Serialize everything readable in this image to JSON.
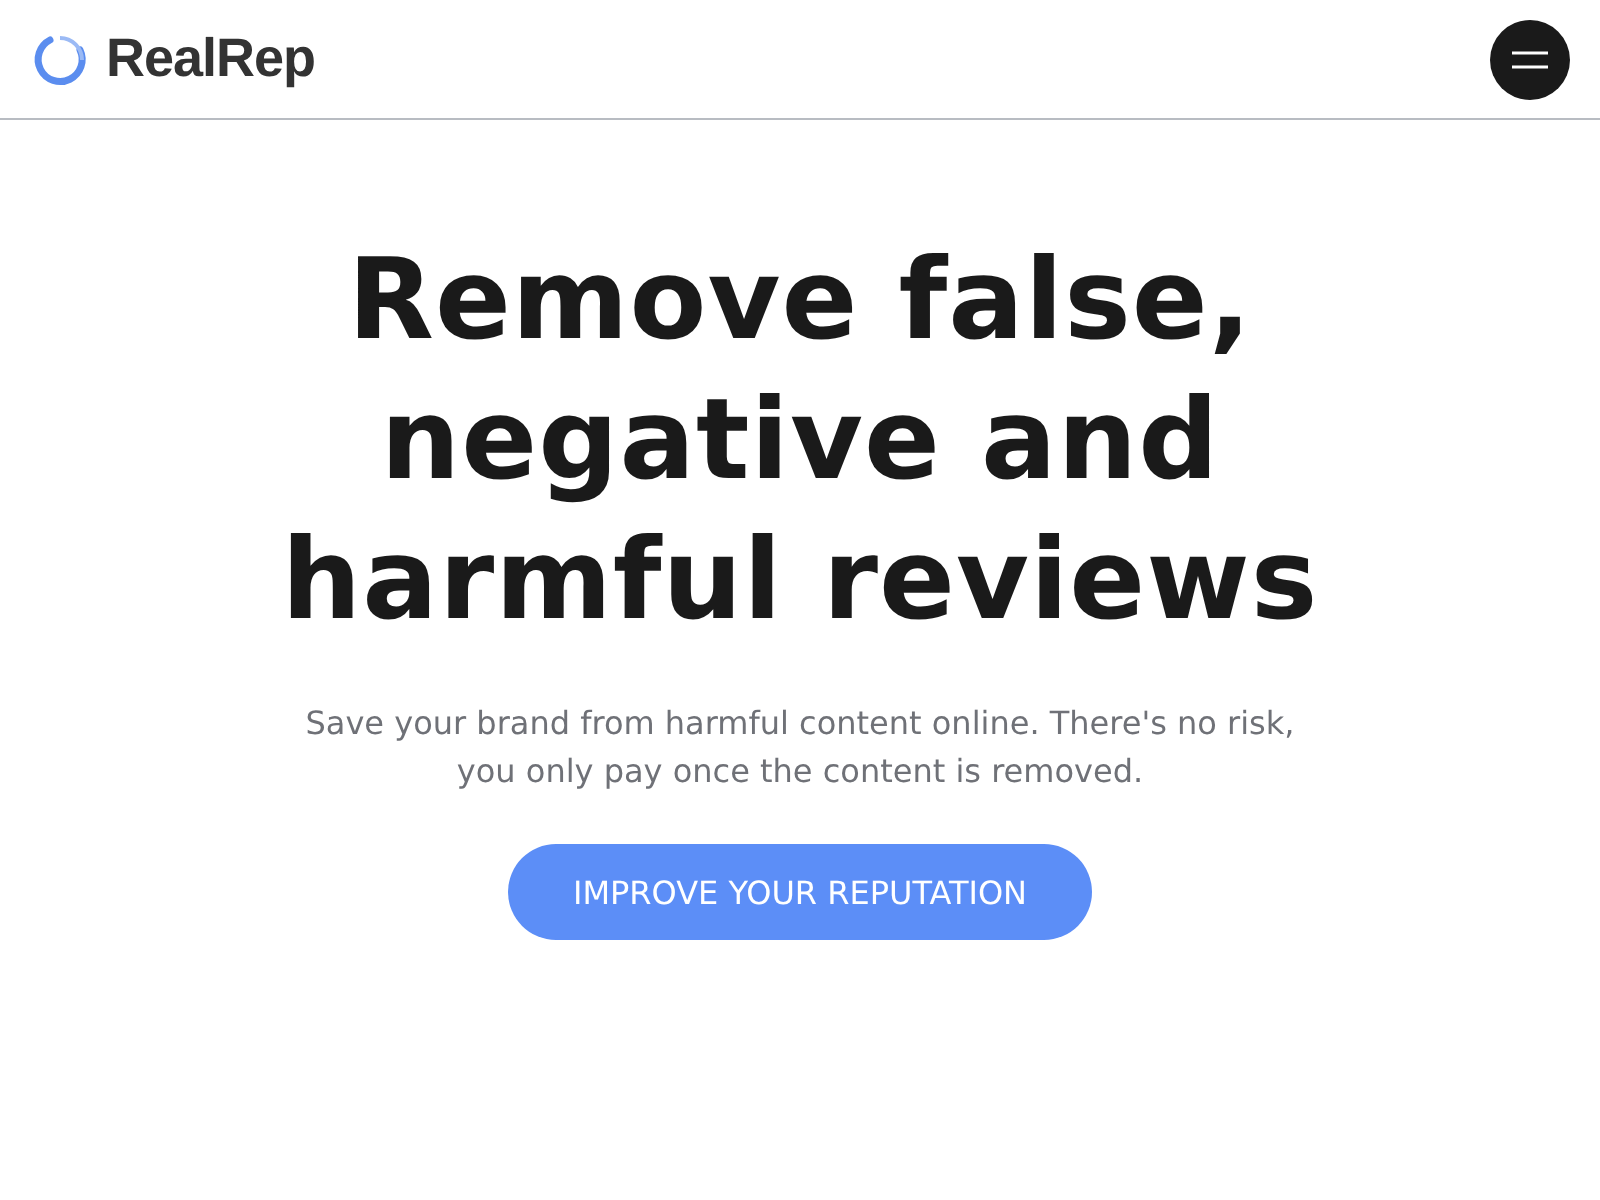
{
  "header": {
    "brand": "RealRep"
  },
  "hero": {
    "title": "Remove false, negative and harmful reviews",
    "subtitle": "Save your brand from harmful content online. There's no risk, you only pay once the content is removed.",
    "cta": "IMPROVE YOUR REPUTATION"
  }
}
